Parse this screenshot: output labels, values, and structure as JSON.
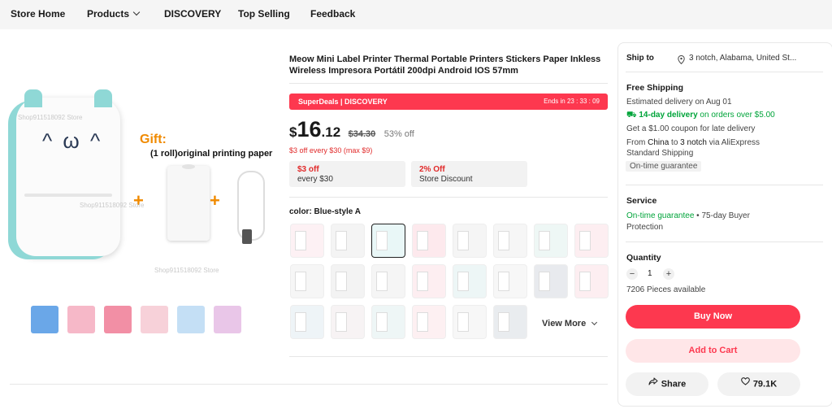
{
  "nav": {
    "items": [
      "Store Home",
      "Products",
      "DISCOVERY",
      "Top Selling",
      "Feedback"
    ]
  },
  "gallery": {
    "gift_title": "Gift:",
    "gift_sub": "(1 roll)original printing paper",
    "plus": "+",
    "watermark": "Shop911518092 Store",
    "face": "^ ω ^",
    "thumb_colors": [
      "#6aa7e8",
      "#f6b8c8",
      "#f28fa5",
      "#f7d1d9",
      "#c4dff5",
      "#e9c6e8"
    ]
  },
  "product": {
    "title": "Meow Mini Label Printer Thermal Portable Printers Stickers Paper Inkless Wireless Impresora Portátil 200dpi Android IOS 57mm",
    "deal_brand": "SuperDeals | DISCOVERY",
    "deal_ends": "Ends in 23 : 33 : 09",
    "currency": "$",
    "price_main": "16",
    "price_dec": ".12",
    "original_price": "$34.30",
    "discount": "53% off",
    "promo": "$3 off every $30 (max $9)",
    "coupons": [
      {
        "a": "$3 off",
        "b": "every $30"
      },
      {
        "a": "2% Off",
        "b": "Store Discount"
      }
    ],
    "color_label": "color: Blue-style A",
    "swatch_tints": [
      "#fdf1f4",
      "#f4f4f4",
      "#e9f7f7",
      "#fde9ed",
      "#f5f5f5",
      "#f6f6f6",
      "#eef7f5",
      "#fdeef1",
      "#f6f6f6",
      "#f3f3f3",
      "#f5f5f5",
      "#fdeef1",
      "#edf6f6",
      "#f7f7f7",
      "#e8eaee",
      "#fdeef1",
      "#eef4f7",
      "#f7f3f4",
      "#eef6f6",
      "#fdf0f2",
      "#f7f7f7",
      "#e9ecef"
    ],
    "selected_swatch": 2,
    "view_more": "View More"
  },
  "side": {
    "ship_to_label": "Ship to",
    "ship_to_value": "3 notch, Alabama, United St...",
    "free_shipping": "Free Shipping",
    "estimated": "Estimated delivery on Aug 01",
    "fast_delivery_bold": "14-day delivery",
    "fast_delivery_rest": "on orders over $5.00",
    "coupon_late": "Get a $1.00 coupon for late delivery",
    "from_prefix": "From",
    "from_country": "China",
    "from_mid": "to",
    "from_dest": "3 notch",
    "from_suffix": "via AliExpress",
    "standard": "Standard Shipping",
    "on_time_tag": "On-time guarantee",
    "service_head": "Service",
    "service_green": "On-time guarantee",
    "service_rest": " • 75-day Buyer",
    "service_line2": "Protection",
    "quantity_head": "Quantity",
    "minus": "−",
    "qty": "1",
    "plus": "+",
    "available": "7206 Pieces available",
    "buy_now": "Buy Now",
    "add_to_cart": "Add to Cart",
    "share": "Share",
    "wishlist_count": "79.1K"
  }
}
